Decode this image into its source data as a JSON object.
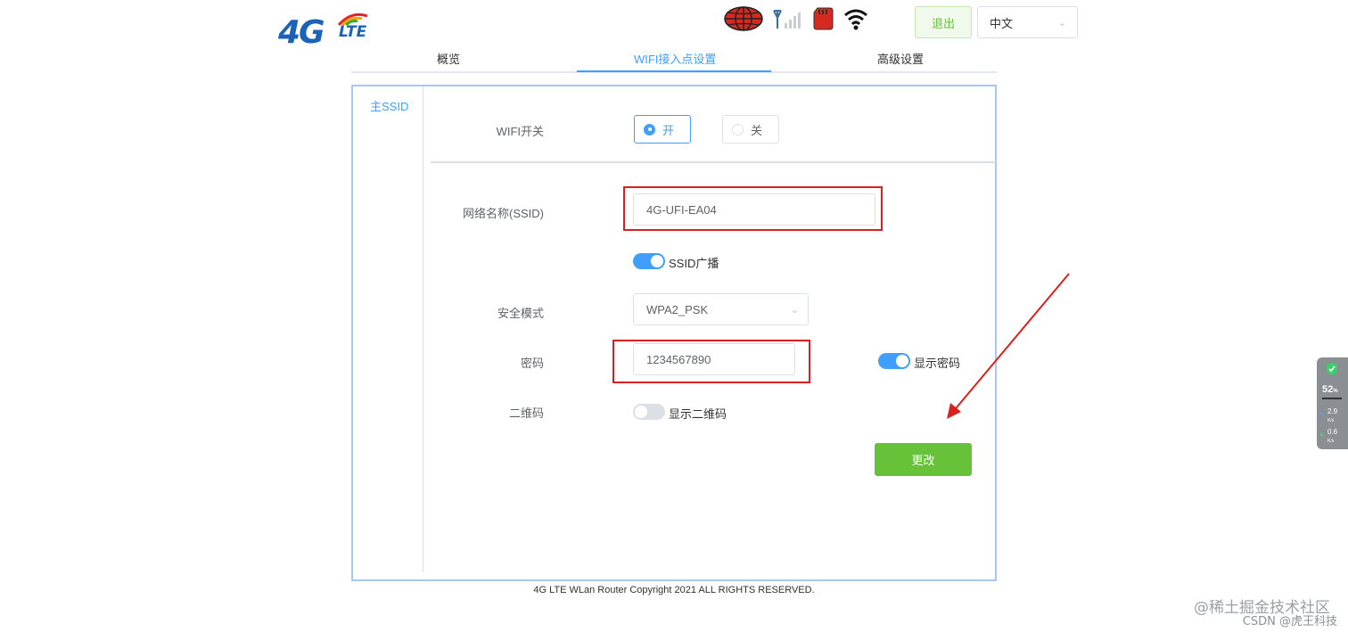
{
  "header": {
    "logo_main": "4G",
    "logo_sub": "LTE",
    "status_icons": [
      "globe-icon",
      "signal-icon",
      "sim-card-icon",
      "wifi-icon"
    ],
    "logout_label": "退出",
    "language_value": "中文"
  },
  "tabs": [
    {
      "label": "概览",
      "active": false
    },
    {
      "label": "WIFI接入点设置",
      "active": true
    },
    {
      "label": "高级设置",
      "active": false
    }
  ],
  "sidenav": {
    "items": [
      {
        "label": "主SSID",
        "active": true
      }
    ]
  },
  "form": {
    "wifi_switch": {
      "label": "WIFI开关",
      "on_label": "开",
      "off_label": "关",
      "selected": "开"
    },
    "ssid": {
      "label": "网络名称(SSID)",
      "value": "4G-UFI-EA04"
    },
    "ssid_broadcast": {
      "label": "SSID广播",
      "enabled": true
    },
    "security_mode": {
      "label": "安全模式",
      "value": "WPA2_PSK"
    },
    "password": {
      "label": "密码",
      "value": "1234567890"
    },
    "show_password": {
      "label": "显示密码",
      "enabled": true
    },
    "qrcode": {
      "label": "二维码",
      "toggle_label": "显示二维码",
      "enabled": false
    },
    "submit_label": "更改"
  },
  "footer": {
    "copyright": "4G LTE WLan Router Copyright 2021 ALL RIGHTS RESERVED."
  },
  "widget": {
    "percent": "52",
    "percent_unit": "%",
    "upload": "2.9",
    "upload_unit": "K/s",
    "download": "0.6",
    "download_unit": "K/s"
  },
  "watermark": {
    "line1": "@稀土掘金技术社区",
    "line2": "CSDN @虎王科技"
  },
  "colors": {
    "accent": "#409eff",
    "success": "#67c23a",
    "highlight": "#d9201e",
    "logo": "#1c62b8"
  }
}
